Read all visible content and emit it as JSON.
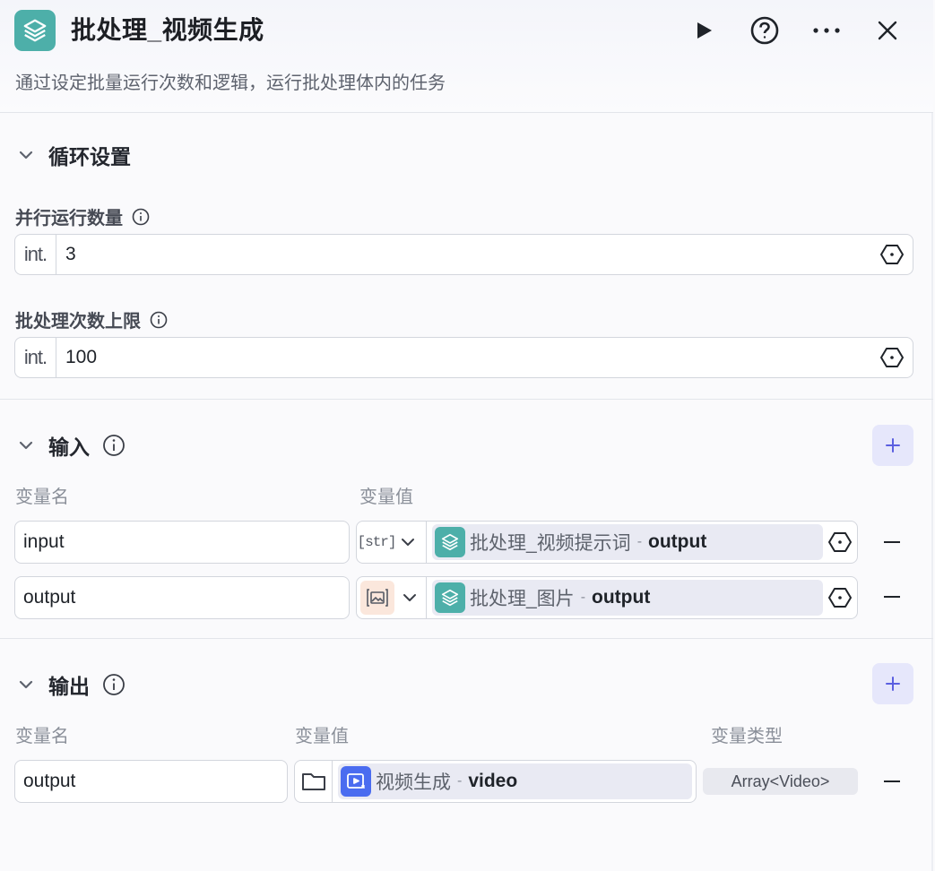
{
  "header": {
    "title": "批处理_视频生成",
    "description": "通过设定批量运行次数和逻辑，运行批处理体内的任务",
    "icons": [
      "layers-icon",
      "play-icon",
      "help-icon",
      "more-icon",
      "close-icon"
    ]
  },
  "loop_settings": {
    "title": "循环设置",
    "concurrency": {
      "label": "并行运行数量",
      "type_tag": "int.",
      "value": "3"
    },
    "batch_limit": {
      "label": "批处理次数上限",
      "type_tag": "int.",
      "value": "100"
    }
  },
  "inputs": {
    "title": "输入",
    "col_name": "变量名",
    "col_value": "变量值",
    "rows": [
      {
        "name": "input",
        "type_tag": "[str]",
        "ref_node": "批处理_视频提示词",
        "sep": "-",
        "ref_var": "output"
      },
      {
        "name": "output",
        "type_tag": "image",
        "ref_node": "批处理_图片",
        "sep": "-",
        "ref_var": "output"
      }
    ]
  },
  "outputs": {
    "title": "输出",
    "col_name": "变量名",
    "col_value": "变量值",
    "col_type": "变量类型",
    "rows": [
      {
        "name": "output",
        "ref_node": "视频生成",
        "sep": "-",
        "ref_var": "video",
        "var_type": "Array<Video>"
      }
    ]
  },
  "colors": {
    "accent_teal": "#4dafa9",
    "accent_blue": "#4a6cf0",
    "add_button_bg": "#e6e7fb",
    "add_button_fg": "#5b5fe0"
  }
}
